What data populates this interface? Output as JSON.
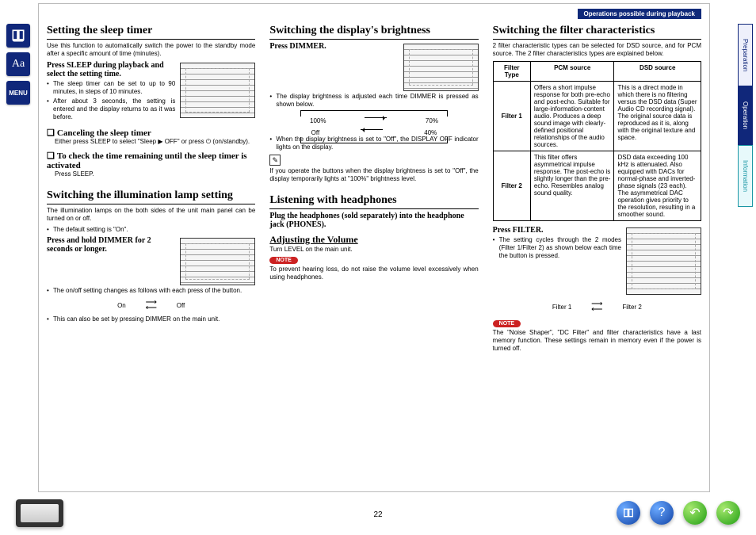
{
  "banner": "Operations possible during playback",
  "page_number": "22",
  "left_rail": {
    "book": "book-icon",
    "aa": "Aa",
    "menu": "MENU"
  },
  "right_tabs": {
    "prep": "Preparation",
    "op": "Operation",
    "info": "Information"
  },
  "col1": {
    "h_sleep": "Setting the sleep timer",
    "sleep_intro": "Use this function to automatically switch the power to the standby mode after a specific amount of time (minutes).",
    "sleep_instr": "Press SLEEP during playback and select the setting time.",
    "sleep_b1": "The sleep timer can be set to up to 90 minutes, in steps of 10 minutes.",
    "sleep_b2": "After about 3 seconds, the setting is entered and the display returns to as it was before.",
    "h_cancel": "Canceling the sleep timer",
    "cancel_txt": "Either press SLEEP to select \"Sleep ▶ OFF\" or press ⏻ (on/standby).",
    "h_check": "To check the time remaining until the sleep timer is activated",
    "check_txt": "Press SLEEP.",
    "h_lamp": "Switching the illumination lamp setting",
    "lamp_intro": "The illumination lamps on the both sides of the unit main panel can be turned on or off.",
    "lamp_default": "The default setting is \"On\".",
    "lamp_instr": "Press and hold DIMMER for 2 seconds or longer.",
    "lamp_b1": "The on/off setting changes as follows with each press of the button.",
    "lamp_b2": "This can also be set by pressing DIMMER on the main unit.",
    "state_on": "On",
    "state_off": "Off"
  },
  "col2": {
    "h_bright": "Switching the display's brightness",
    "bright_instr": "Press DIMMER.",
    "bright_b1": "The display brightness is adjusted each time DIMMER is pressed as shown below.",
    "p100": "100%",
    "p70": "70%",
    "poff": "Off",
    "p40": "40%",
    "bright_b2": "When the display brightness is set to \"Off\", the DISPLAY OFF indicator lights on the display.",
    "pencil_note": "If you operate the buttons when the display brightness is set to \"Off\", the display temporarily lights at \"100%\" brightness level.",
    "h_head": "Listening with headphones",
    "head_instr": "Plug the headphones (sold separately) into the headphone jack (PHONES).",
    "h_adj": "Adjusting the Volume",
    "adj_txt": "Turn LEVEL on the main unit.",
    "note_label": "NOTE",
    "note_txt": "To prevent hearing loss, do not raise the volume level excessively when using headphones."
  },
  "col3": {
    "h_filter": "Switching the filter characteristics",
    "filter_intro": "2 filter characteristic types can be selected for DSD source, and for PCM source. The 2 filter characteristics types are explained below.",
    "th_type": "Filter Type",
    "th_pcm": "PCM source",
    "th_dsd": "DSD source",
    "f1_label": "Filter 1",
    "f1_pcm": "Offers a short impulse response for both pre-echo and post-echo. Suitable for large-information-content audio. Produces a deep sound image with clearly-defined positional relationships of the audio sources.",
    "f1_dsd": "This is a direct mode in which there is no filtering versus the DSD data (Super Audio CD recording signal). The original source data is reproduced as it is, along with the original texture and space.",
    "f2_label": "Filter 2",
    "f2_pcm": "This filter offers asymmetrical impulse response. The post-echo is slightly longer than the pre-echo. Resembles analog sound quality.",
    "f2_dsd": "DSD data exceeding 100 kHz is attenuated. Also equipped with DACs for normal-phase and inverted-phase signals (23 each). The asymmetrical DAC operation gives priority to the resolution, resulting in a smoother sound.",
    "filter_instr": "Press FILTER.",
    "filter_b1": "The setting cycles through the 2 modes (Filter 1/Filter 2) as shown below each time the button is pressed.",
    "cycle_f1": "Filter 1",
    "cycle_f2": "Filter 2",
    "note_label": "NOTE",
    "note_txt": "The \"Noise Shaper\", \"DC Filter\" and filter characteristics have a last memory function. These settings remain in memory even if the power is turned off."
  },
  "footer_nav": {
    "toc": "toc-icon",
    "help": "help-icon",
    "back": "back-icon",
    "fwd": "forward-icon"
  }
}
